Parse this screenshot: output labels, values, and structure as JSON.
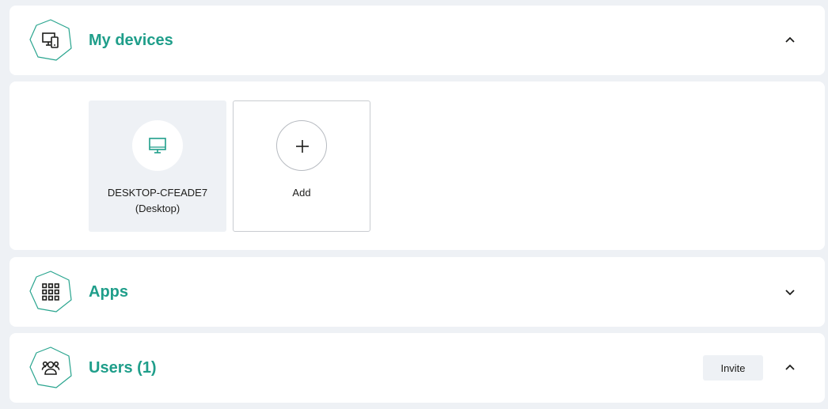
{
  "sections": {
    "my_devices": {
      "title": "My devices",
      "expanded": true,
      "icon": "devices-icon"
    },
    "apps": {
      "title": "Apps",
      "expanded": false,
      "icon": "apps-grid-icon"
    },
    "users": {
      "title": "Users (1)",
      "expanded": true,
      "icon": "users-icon",
      "invite_label": "Invite"
    }
  },
  "devices": [
    {
      "name": "DESKTOP-CFEADE7",
      "type": "(Desktop)",
      "icon": "monitor-icon"
    }
  ],
  "add_tile": {
    "label": "Add",
    "icon": "plus-icon"
  },
  "colors": {
    "accent": "#1f9e8a",
    "background": "#eef1f5",
    "card": "#ffffff"
  }
}
